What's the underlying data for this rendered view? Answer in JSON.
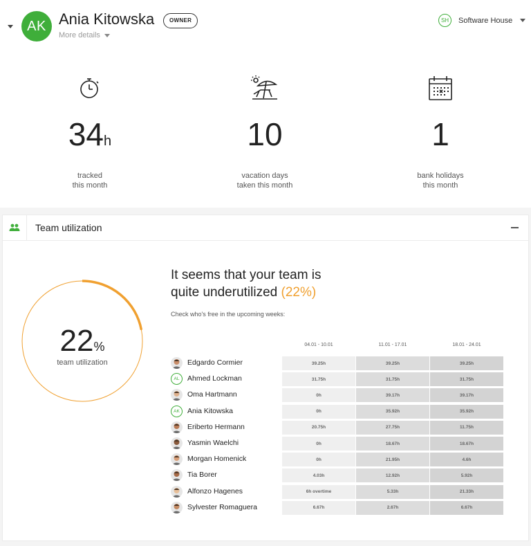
{
  "header": {
    "avatar_initials": "AK",
    "name": "Ania Kitowska",
    "role_badge": "OWNER",
    "more_details": "More details",
    "org_initials": "SH",
    "org_name": "Software House"
  },
  "stats": [
    {
      "icon": "stopwatch-icon",
      "value": "34",
      "unit": "h",
      "caption_line1": "tracked",
      "caption_line2": "this month"
    },
    {
      "icon": "beach-chair-icon",
      "value": "10",
      "unit": "",
      "caption_line1": "vacation days",
      "caption_line2": "taken this month"
    },
    {
      "icon": "calendar-icon",
      "value": "1",
      "unit": "",
      "caption_line1": "bank holidays",
      "caption_line2": "this month"
    }
  ],
  "team_card": {
    "title": "Team utilization",
    "utilization_value": "22",
    "utilization_percent": 22,
    "utilization_unit": "%",
    "utilization_caption": "team utilization",
    "headline_line1": "It seems that your team is",
    "headline_line2_prefix": "quite underutilized",
    "headline_highlight": "(22%)",
    "subline": "Check who's free in the upcoming weeks:",
    "weeks": [
      "04.01 - 10.01",
      "11.01 - 17.01",
      "18.01 - 24.01"
    ],
    "people": [
      {
        "name": "Edgardo Cormier",
        "avatar": "photo",
        "initials": "",
        "hours": [
          "39.25h",
          "39.25h",
          "39.25h"
        ]
      },
      {
        "name": "Ahmed Lockman",
        "avatar": "initials",
        "initials": "AL",
        "hours": [
          "31.75h",
          "31.75h",
          "31.75h"
        ]
      },
      {
        "name": "Oma Hartmann",
        "avatar": "photo",
        "initials": "",
        "hours": [
          "0h",
          "39.17h",
          "39.17h"
        ]
      },
      {
        "name": "Ania Kitowska",
        "avatar": "initials",
        "initials": "AK",
        "hours": [
          "0h",
          "35.92h",
          "35.92h"
        ]
      },
      {
        "name": "Eriberto Hermann",
        "avatar": "photo",
        "initials": "",
        "hours": [
          "20.75h",
          "27.75h",
          "11.75h"
        ]
      },
      {
        "name": "Yasmin Waelchi",
        "avatar": "photo",
        "initials": "",
        "hours": [
          "0h",
          "18.67h",
          "18.67h"
        ]
      },
      {
        "name": "Morgan Homenick",
        "avatar": "photo",
        "initials": "",
        "hours": [
          "0h",
          "21.95h",
          "4.6h"
        ]
      },
      {
        "name": "Tia Borer",
        "avatar": "photo",
        "initials": "",
        "hours": [
          "4.03h",
          "12.92h",
          "5.92h"
        ]
      },
      {
        "name": "Alfonzo Hagenes",
        "avatar": "photo",
        "initials": "",
        "hours": [
          "6h overtime",
          "5.33h",
          "21.33h"
        ]
      },
      {
        "name": "Sylvester Romaguera",
        "avatar": "photo",
        "initials": "",
        "hours": [
          "6.67h",
          "2.67h",
          "6.67h"
        ]
      }
    ]
  },
  "colors": {
    "brand_green": "#3fae3a",
    "accent_orange": "#f0a030",
    "cell_week1": "#efefef",
    "cell_week2": "#dcdcdc",
    "cell_week3": "#d3d3d3"
  }
}
